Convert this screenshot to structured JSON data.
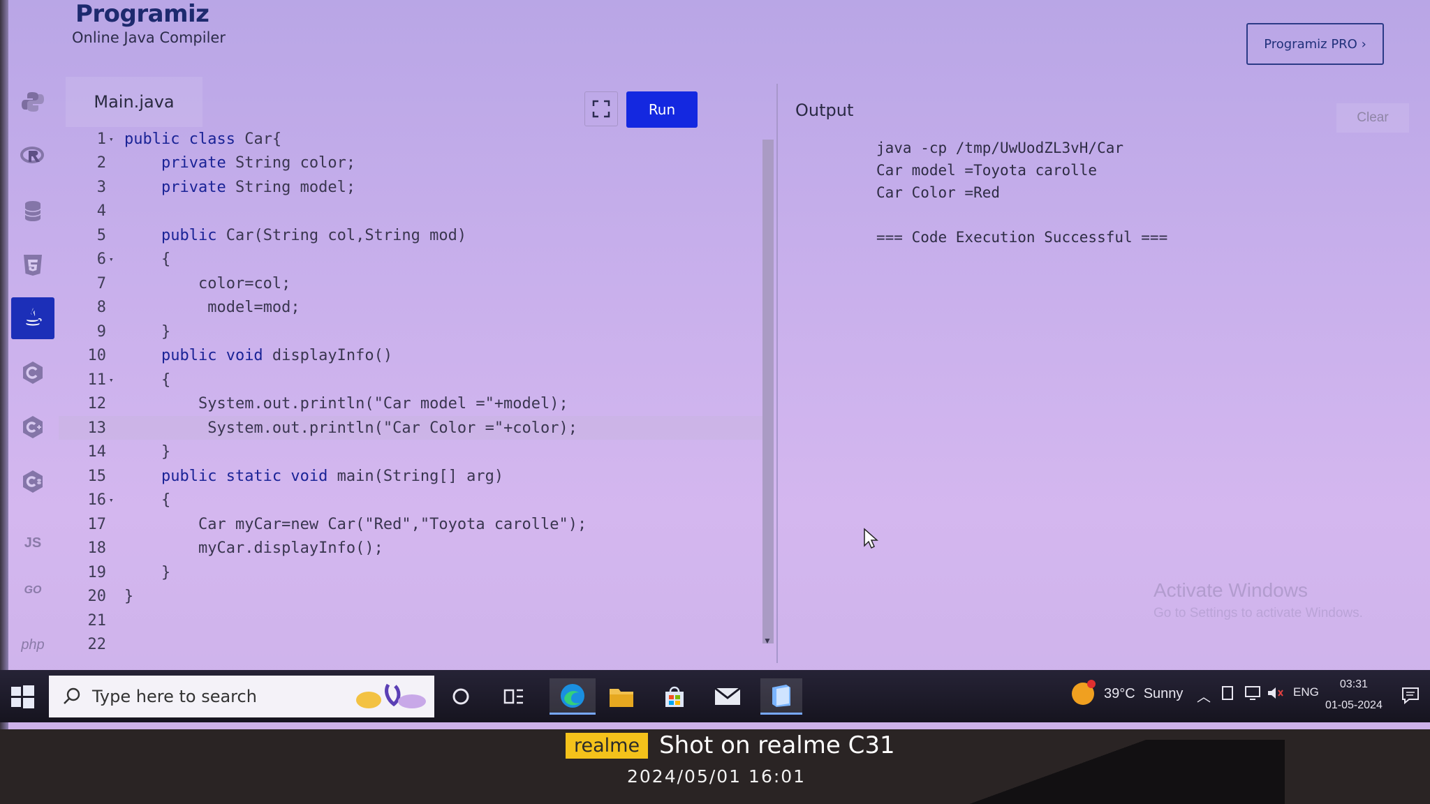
{
  "header": {
    "logo": "Programiz",
    "subtitle": "Online Java Compiler",
    "pro_button": "Programiz PRO ›"
  },
  "sidebar": {
    "languages": [
      {
        "name": "python-icon",
        "label": ""
      },
      {
        "name": "r-icon",
        "label": ""
      },
      {
        "name": "database-icon",
        "label": ""
      },
      {
        "name": "html5-icon",
        "label": ""
      },
      {
        "name": "java-icon",
        "label": "",
        "active": true
      },
      {
        "name": "c-icon",
        "label": ""
      },
      {
        "name": "cpp-icon",
        "label": ""
      },
      {
        "name": "csharp-icon",
        "label": ""
      },
      {
        "name": "js-icon",
        "label": "JS"
      },
      {
        "name": "go-icon",
        "label": "GO"
      },
      {
        "name": "php-icon",
        "label": "php"
      }
    ]
  },
  "editor": {
    "file_tab": "Main.java",
    "run_label": "Run",
    "lines": [
      {
        "n": "1",
        "fold": "▾",
        "indent": "",
        "kw": "public class",
        "rest": " Car{"
      },
      {
        "n": "2",
        "fold": "",
        "indent": "    ",
        "kw": "private",
        "rest": " String color;"
      },
      {
        "n": "3",
        "fold": "",
        "indent": "    ",
        "kw": "private",
        "rest": " String model;"
      },
      {
        "n": "4",
        "fold": "",
        "indent": "",
        "kw": "",
        "rest": ""
      },
      {
        "n": "5",
        "fold": "",
        "indent": "    ",
        "kw": "public",
        "rest": " Car(String col,String mod)"
      },
      {
        "n": "6",
        "fold": "▾",
        "indent": "    ",
        "kw": "",
        "rest": "{"
      },
      {
        "n": "7",
        "fold": "",
        "indent": "        ",
        "kw": "",
        "rest": "color=col;"
      },
      {
        "n": "8",
        "fold": "",
        "indent": "         ",
        "kw": "",
        "rest": "model=mod;"
      },
      {
        "n": "9",
        "fold": "",
        "indent": "    ",
        "kw": "",
        "rest": "}"
      },
      {
        "n": "10",
        "fold": "",
        "indent": "    ",
        "kw": "public void",
        "rest": " displayInfo()"
      },
      {
        "n": "11",
        "fold": "▾",
        "indent": "    ",
        "kw": "",
        "rest": "{"
      },
      {
        "n": "12",
        "fold": "",
        "indent": "        ",
        "kw": "",
        "rest": "System.out.println(\"Car model =\"+model);"
      },
      {
        "n": "13",
        "fold": "",
        "indent": "         ",
        "kw": "",
        "rest": "System.out.println(\"Car Color =\"+color);"
      },
      {
        "n": "14",
        "fold": "",
        "indent": "    ",
        "kw": "",
        "rest": "}"
      },
      {
        "n": "15",
        "fold": "",
        "indent": "    ",
        "kw": "public static void",
        "rest": " main(String[] arg)"
      },
      {
        "n": "16",
        "fold": "▾",
        "indent": "    ",
        "kw": "",
        "rest": "{"
      },
      {
        "n": "17",
        "fold": "",
        "indent": "        ",
        "kw": "",
        "rest": "Car myCar=new Car(\"Red\",\"Toyota carolle\");"
      },
      {
        "n": "18",
        "fold": "",
        "indent": "        ",
        "kw": "",
        "rest": "myCar.displayInfo();"
      },
      {
        "n": "19",
        "fold": "",
        "indent": "    ",
        "kw": "",
        "rest": "}"
      },
      {
        "n": "20",
        "fold": "",
        "indent": "",
        "kw": "",
        "rest": "}"
      },
      {
        "n": "21",
        "fold": "",
        "indent": "",
        "kw": "",
        "rest": ""
      },
      {
        "n": "22",
        "fold": "",
        "indent": "",
        "kw": "",
        "rest": ""
      }
    ],
    "highlighted_line": "13"
  },
  "output": {
    "title": "Output",
    "clear_label": "Clear",
    "lines": [
      "java -cp /tmp/UwUodZL3vH/Car",
      "Car model =Toyota carolle",
      "Car Color =Red",
      "",
      "=== Code Execution Successful ==="
    ]
  },
  "watermark": {
    "line1": "Activate Windows",
    "line2": "Go to Settings to activate Windows."
  },
  "taskbar": {
    "search_placeholder": "Type here to search",
    "weather_temp": "39°C",
    "weather_desc": "Sunny",
    "language": "ENG",
    "time": "03:31",
    "date": "01-05-2024"
  },
  "photo_stamp": {
    "brand": "realme",
    "shot_on": "Shot on realme C31",
    "datetime": "2024/05/01  16:01"
  },
  "colors": {
    "accent": "#1428e0",
    "keyword": "#1a2396",
    "brand_tag": "#f4c21b"
  }
}
